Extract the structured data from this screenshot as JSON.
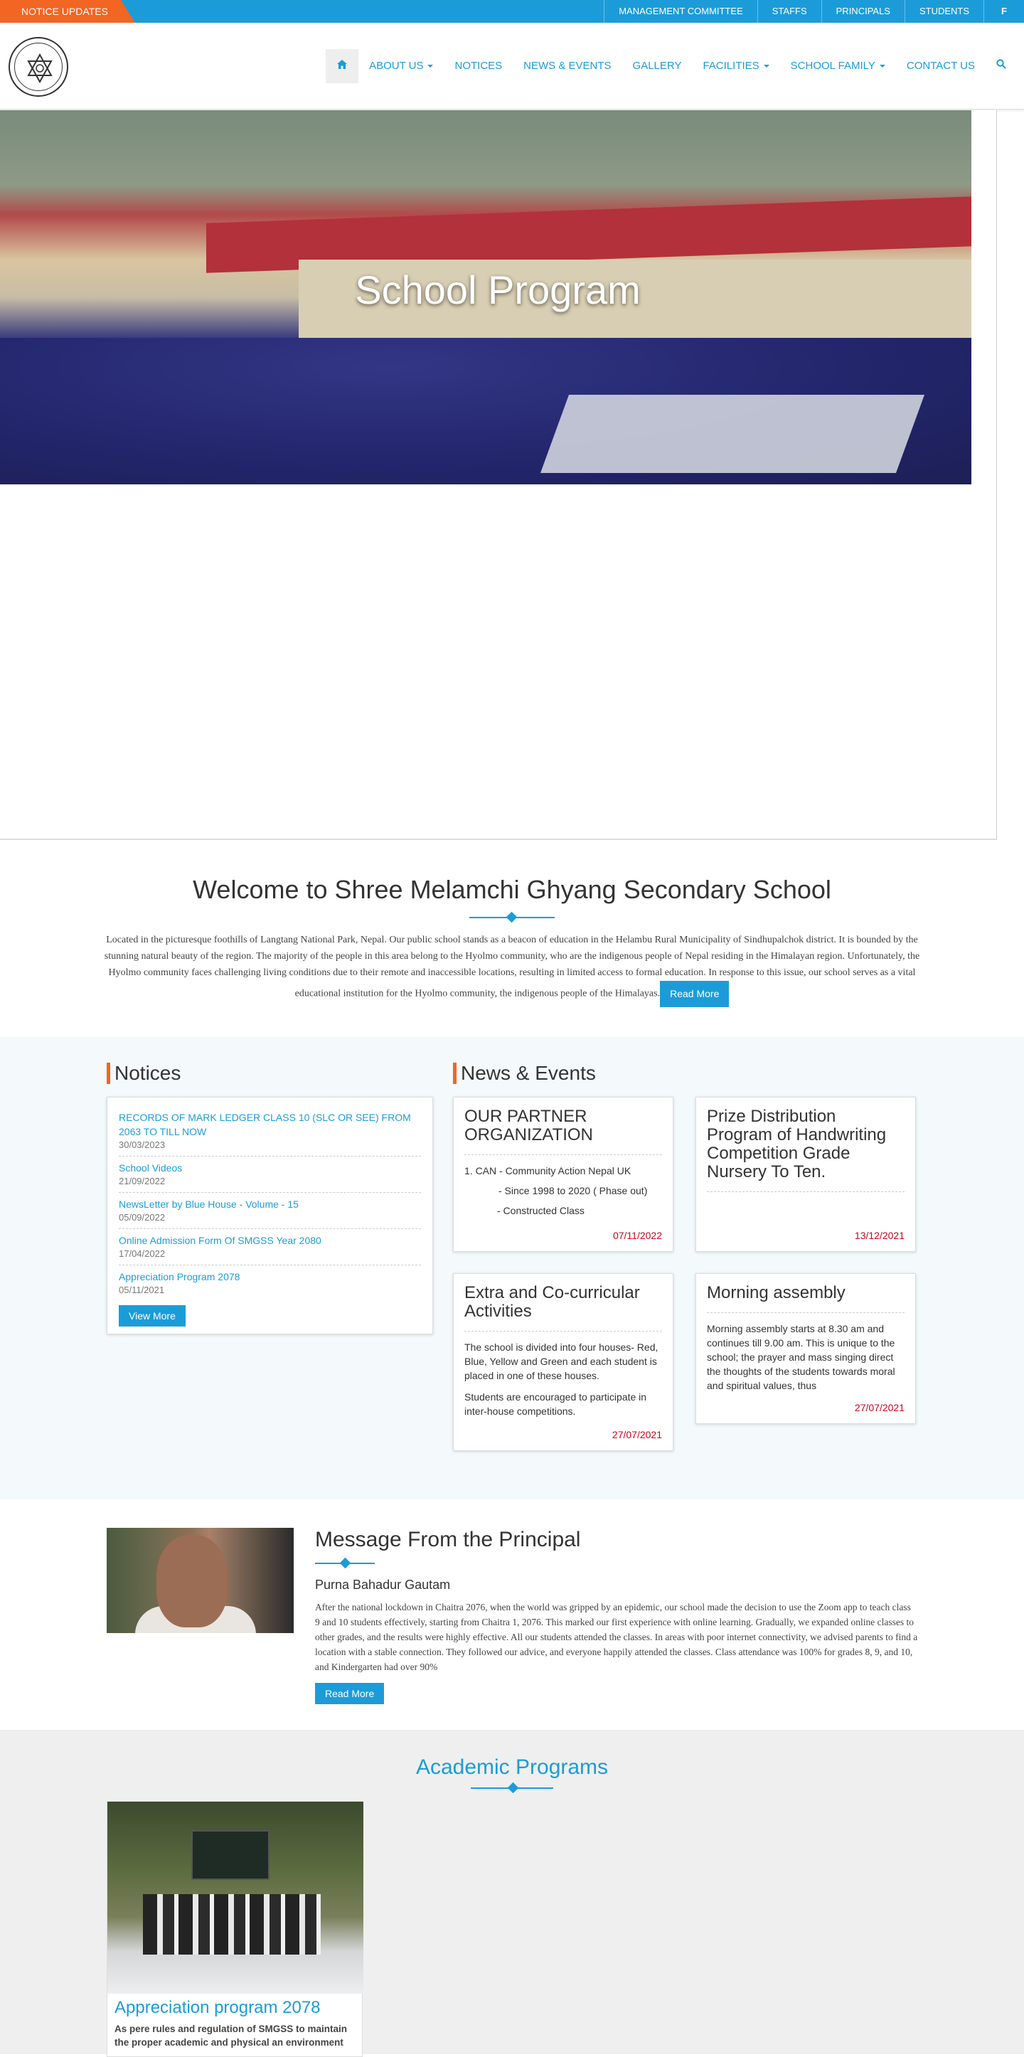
{
  "topbar": {
    "notice_label": "NOTICE UPDATES",
    "links": [
      "MANAGEMENT COMMITTEE",
      "STAFFS",
      "PRINCIPALS",
      "STUDENTS"
    ],
    "facebook": "f",
    "color": "#1b9cd9",
    "accent": "#f26522"
  },
  "nav": {
    "items": [
      {
        "label": "ABOUT US",
        "dropdown": true
      },
      {
        "label": "NOTICES",
        "dropdown": false
      },
      {
        "label": "NEWS & EVENTS",
        "dropdown": false
      },
      {
        "label": "GALLERY",
        "dropdown": false
      },
      {
        "label": "FACILITIES",
        "dropdown": true
      },
      {
        "label": "SCHOOL FAMILY",
        "dropdown": true
      },
      {
        "label": "CONTACT US",
        "dropdown": false
      }
    ],
    "home_icon": "home-icon",
    "search_icon": "search-icon"
  },
  "hero": {
    "title": "School Program"
  },
  "welcome": {
    "title": "Welcome to Shree Melamchi Ghyang Secondary School",
    "text": "Located in the picturesque foothills of Langtang National Park, Nepal. Our public school stands as a beacon of education in the Helambu Rural Municipality of Sindhupalchok district. It is bounded by the stunning natural beauty of the region. The majority of the people in this area belong to the Hyolmo community, who are the indigenous people of Nepal residing in the Himalayan region. Unfortunately, the Hyolmo community faces challenging living conditions due to their remote and inaccessible locations, resulting in limited access to formal education. In response to this issue, our school serves as a vital educational institution for the Hyolmo community, the indigenous people of the Himalayas.",
    "read_more": "Read More"
  },
  "notices": {
    "title": "Notices",
    "items": [
      {
        "title": "RECORDS OF MARK LEDGER CLASS 10 (SLC OR SEE) FROM 2063 TO TILL NOW",
        "date": "30/03/2023"
      },
      {
        "title": "School Videos",
        "date": "21/09/2022"
      },
      {
        "title": "NewsLetter by Blue House - Volume - 15",
        "date": "05/09/2022"
      },
      {
        "title": "Online Admission Form Of SMGSS Year 2080",
        "date": "17/04/2022"
      },
      {
        "title": "Appreciation Program 2078",
        "date": "05/11/2021"
      }
    ],
    "view_more": "View More"
  },
  "news": {
    "title": "News & Events",
    "cards": [
      {
        "title": "OUR PARTNER ORGANIZATION",
        "lines": [
          "1. CAN - Community Action Nepal UK",
          "- Since 1998 to 2020 ( Phase out)",
          "- Constructed Class"
        ],
        "date": "07/11/2022"
      },
      {
        "title": "Prize Distribution Program of Handwriting Competition Grade Nursery To Ten.",
        "lines": [],
        "date": "13/12/2021"
      },
      {
        "title": "Extra and Co-curricular Activities",
        "lines": [
          "The school is divided into four houses- Red, Blue, Yellow and Green and each student is placed in one of these houses.",
          "Students are encouraged to participate in inter-house competitions."
        ],
        "date": "27/07/2021"
      },
      {
        "title": "Morning assembly",
        "lines": [
          "Morning assembly starts at 8.30 am and continues till 9.00 am. This is unique to the school; the prayer and mass singing direct the thoughts of the students towards moral and spiritual values, thus"
        ],
        "date": "27/07/2021"
      }
    ]
  },
  "principal": {
    "title": "Message From the Principal",
    "name": "Purna Bahadur Gautam",
    "text": "After the national lockdown in Chaitra 2076, when the world was gripped by an epidemic, our school made the decision to use the Zoom app to teach class 9 and 10 students effectively, starting from Chaitra 1, 2076. This marked our first experience with online learning. Gradually, we expanded online classes to other grades, and the results were highly effective. All our students attended the classes. In areas with poor internet connectivity, we advised parents to find a location with a stable connection. They followed our advice, and everyone happily attended the classes. Class attendance was 100% for grades 8, 9, and 10, and Kindergarten had over 90%",
    "read_more": "Read More"
  },
  "academic": {
    "title": "Academic Programs",
    "programs": [
      {
        "title": "Appreciation program 2078",
        "text": "As pere rules and regulation of SMGSS to maintain the proper academic and physical an environment"
      }
    ]
  }
}
